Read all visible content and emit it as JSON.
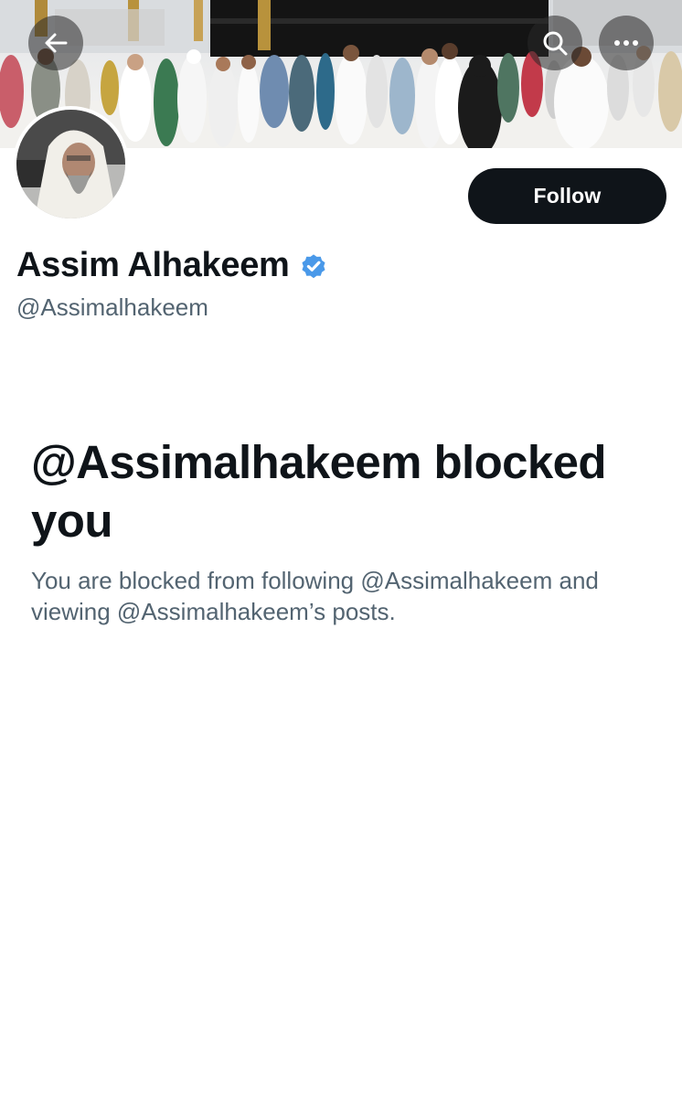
{
  "header": {
    "back_icon": "arrow-left-icon",
    "search_icon": "search-icon",
    "more_icon": "more-horizontal-icon"
  },
  "profile": {
    "display_name": "Assim Alhakeem",
    "handle": "@Assimalhakeem",
    "verified": true,
    "verified_color": "#4a99e9",
    "follow_label": "Follow"
  },
  "blocked": {
    "title": "@Assimalhakeem blocked you",
    "description": "You are blocked from following @Assimalhakeem and viewing @Assimalhakeem’s posts."
  },
  "colors": {
    "primary_text": "#0f1419",
    "secondary_text": "#536471",
    "button_bg": "#0f1419",
    "button_text": "#ffffff"
  }
}
